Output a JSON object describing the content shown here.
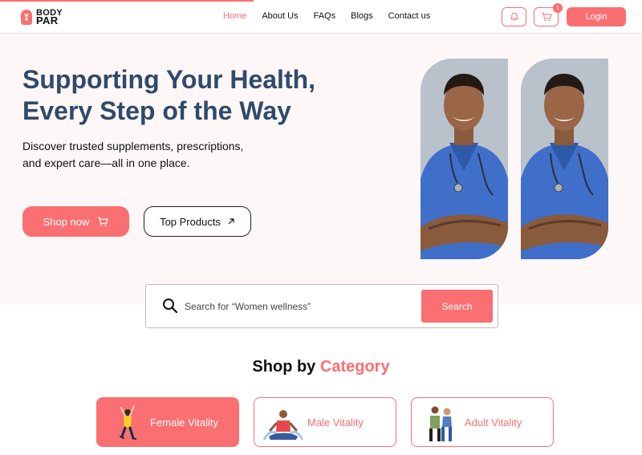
{
  "brand": {
    "line1": "BODY",
    "line2": "PAR"
  },
  "nav": {
    "items": [
      {
        "label": "Home",
        "active": true
      },
      {
        "label": "About Us",
        "active": false
      },
      {
        "label": "FAQs",
        "active": false
      },
      {
        "label": "Blogs",
        "active": false
      },
      {
        "label": "Contact us",
        "active": false
      }
    ]
  },
  "header": {
    "notification_icon": "bell-icon",
    "cart_icon": "cart-icon",
    "cart_count": "1",
    "login_label": "Login"
  },
  "hero": {
    "title_line1": "Supporting Your Health,",
    "title_line2": "Every Step of the Way",
    "subtitle_line1": "Discover trusted supplements, prescriptions,",
    "subtitle_line2": "and expert care—all in one place.",
    "shop_label": "Shop now",
    "top_products_label": "Top Products"
  },
  "search": {
    "placeholder": "Search for “Women wellness”",
    "button_label": "Search"
  },
  "categories": {
    "title_prefix": "Shop by",
    "title_accent": "Category",
    "items": [
      {
        "label": "Female Vitality",
        "selected": true
      },
      {
        "label": "Male Vitality",
        "selected": false
      },
      {
        "label": "Adult Vitality",
        "selected": false
      }
    ]
  },
  "colors": {
    "accent": "#fa6f72",
    "heading": "#2f4a6b",
    "hero_bg": "#fdf7f7"
  }
}
